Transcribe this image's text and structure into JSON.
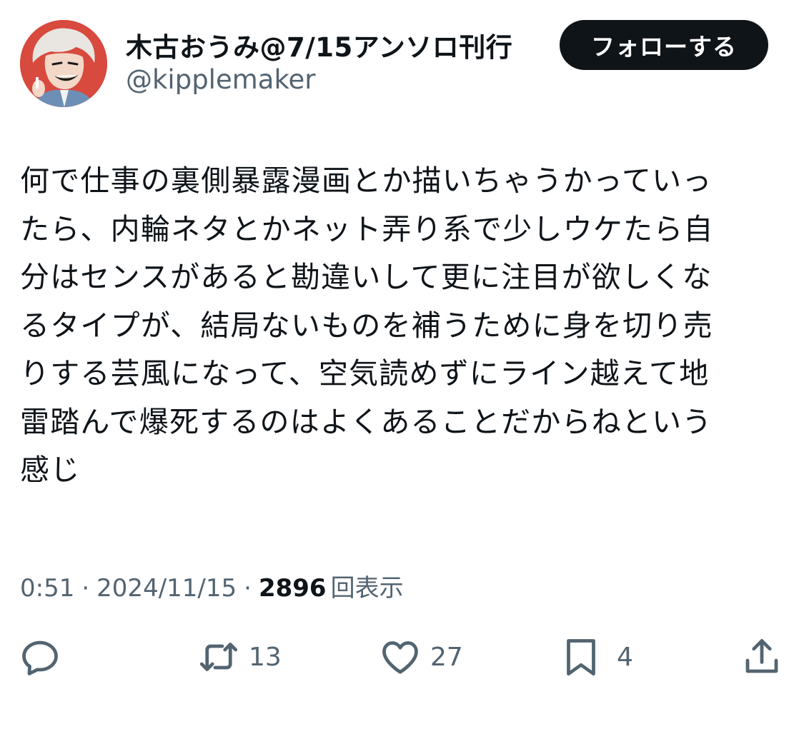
{
  "author": {
    "display_name": "木古おうみ@7/15アンソロ刊行",
    "handle": "@kipplemaker",
    "avatar_icon": "user-avatar-illustration"
  },
  "follow_button": {
    "label": "フォローする"
  },
  "tweet": {
    "lines": [
      "何で仕事の裏側暴露漫画とか描いちゃうかっていっ",
      "たら、内輪ネタとかネット弄り系で少しウケたら自",
      "分はセンスがあると勘違いして更に注目が欲しくな",
      "るタイプが、結局ないものを補うために身を切り売",
      "りする芸風になって、空気読めずにライン越えて地",
      "雷踏んで爆死するのはよくあることだからねという",
      "感じ"
    ]
  },
  "meta": {
    "time": "0:51",
    "separator": "·",
    "date": "2024/11/15",
    "views_count": "2896",
    "views_label": "回表示"
  },
  "actions": {
    "reply": {
      "icon": "reply-icon",
      "count": ""
    },
    "repost": {
      "icon": "repost-icon",
      "count": "13"
    },
    "like": {
      "icon": "heart-icon",
      "count": "27"
    },
    "bookmark": {
      "icon": "bookmark-icon",
      "count": "4"
    },
    "share": {
      "icon": "share-icon",
      "count": ""
    }
  },
  "colors": {
    "text_primary": "#0f1419",
    "text_secondary": "#536471",
    "button_bg": "#0f1419",
    "button_text": "#ffffff",
    "avatar_bg": "#d8493e"
  }
}
